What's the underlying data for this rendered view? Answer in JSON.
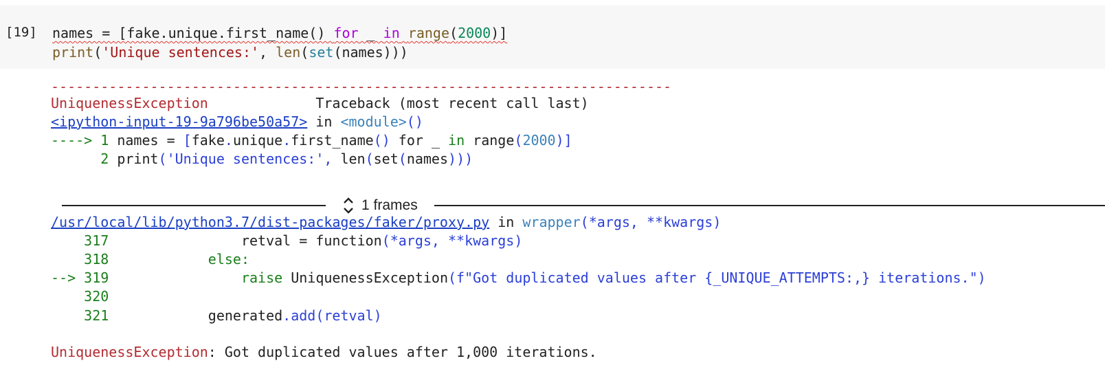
{
  "cell": {
    "number": "[19]",
    "line1": {
      "p1": "names = [fake.unique.first_name() ",
      "for": "for",
      "p2": " _ ",
      "in": "in",
      "sp": " ",
      "range": "range",
      "p3": "(",
      "n": "2000",
      "p4": ")]"
    },
    "line2": {
      "print": "print",
      "p1": "(",
      "str": "'Unique sentences:'",
      "p2": ", ",
      "len": "len",
      "p3": "(",
      "set": "set",
      "p4": "(names)))"
    }
  },
  "traceback": {
    "dashes": "---------------------------------------------------------------------------",
    "exception_name": "UniquenessException",
    "header_right": "Traceback (most recent call last)",
    "input_link": "<ipython-input-19-9a796be50a57>",
    "in_word": " in ",
    "module": "<module>",
    "module_parens": "()",
    "arrow_line": {
      "arrow": "----> 1",
      "code1": " names = ",
      "br1": "[",
      "code2": "fake",
      "dot1": ".",
      "code3": "unique",
      "dot2": ".",
      "code4": "first_name",
      "parens": "()",
      "code5": " for _ ",
      "in": "in",
      "code6": " range",
      "br2": "(",
      "n": "2000",
      "br3": ")]"
    },
    "line2": {
      "num": "      2",
      "code1": " print",
      "p1": "(",
      "str": "'Unique sentences:'",
      "p2": ", ",
      "code2": "len",
      "p3": "(",
      "code3": "set",
      "p4": "(",
      "code4": "names",
      "p5": ")))"
    },
    "frames_label": "1 frames",
    "file_link": "/usr/local/lib/python3.7/dist-packages/faker/proxy.py",
    "file_in": " in ",
    "wrapper": "wrapper",
    "wrapper_args": "(*args, **kwargs)",
    "frame_lines": [
      {
        "num": "    317",
        "indent": "                ",
        "code": "retval = function",
        "tail": "(*args, **kwargs)"
      },
      {
        "num": "    318",
        "indent": "            ",
        "code": "else:",
        "tail": ""
      },
      {
        "num": "--> 319",
        "indent": "                ",
        "code": "raise",
        "tail": " UniquenessException"
      },
      {
        "num": "    320",
        "indent": "",
        "code": "",
        "tail": ""
      },
      {
        "num": "    321",
        "indent": "            ",
        "code": "generated",
        "tail": ".add"
      }
    ],
    "raise_args": "(f\"Got duplicated values after {_UNIQUE_ATTEMPTS:,} iterations.\")",
    "add_args": "(retval)",
    "final_name": "UniquenessException",
    "final_colon": ":",
    "final_message": " Got duplicated values after 1,000 iterations."
  }
}
